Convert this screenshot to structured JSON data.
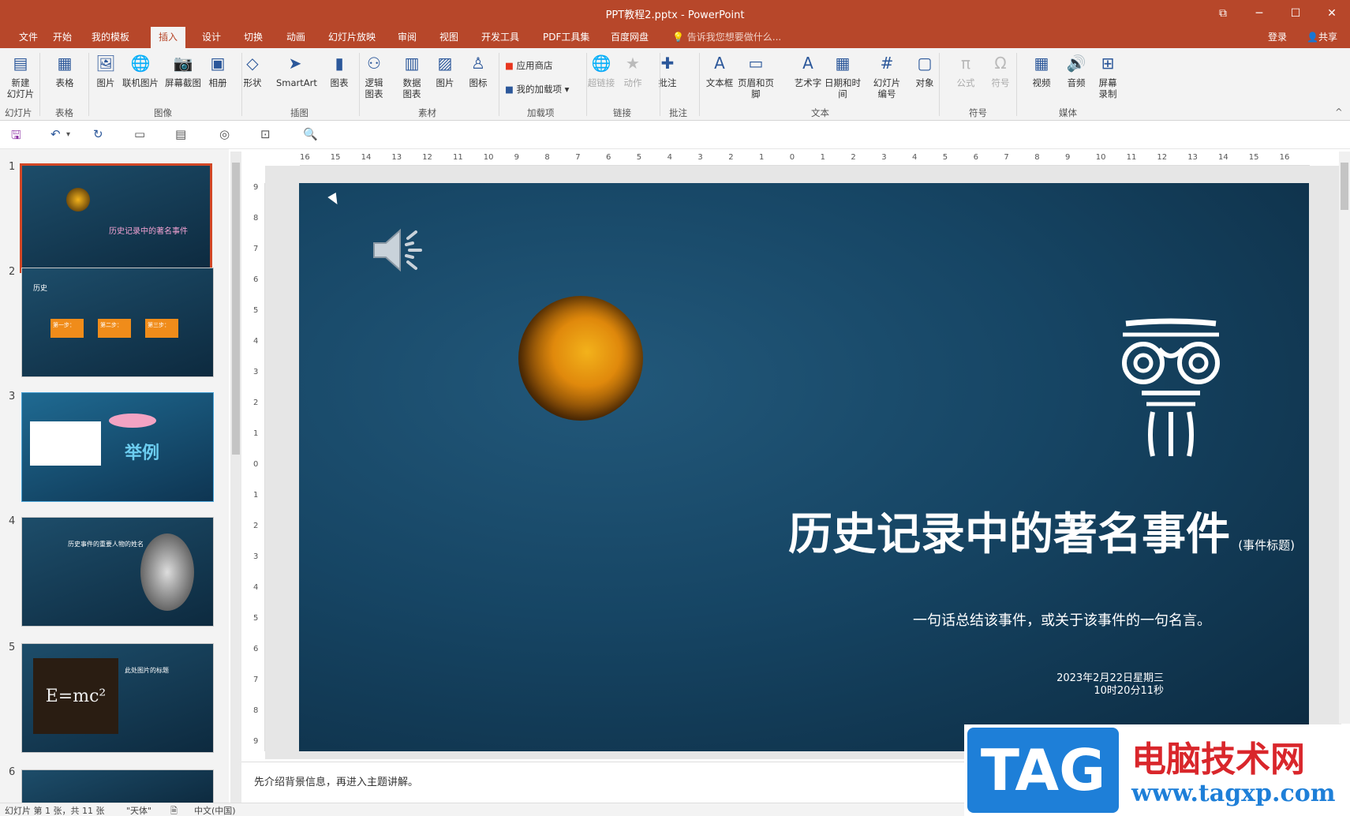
{
  "window": {
    "title": "PPT教程2.pptx - PowerPoint",
    "controls": [
      "⧉",
      "─",
      "☐",
      "✕"
    ]
  },
  "tabs": [
    {
      "label": "文件",
      "active": false
    },
    {
      "label": "开始",
      "active": false
    },
    {
      "label": "我的模板",
      "active": false
    },
    {
      "label": "插入",
      "active": true
    },
    {
      "label": "设计",
      "active": false
    },
    {
      "label": "切换",
      "active": false
    },
    {
      "label": "动画",
      "active": false
    },
    {
      "label": "幻灯片放映",
      "active": false
    },
    {
      "label": "审阅",
      "active": false
    },
    {
      "label": "视图",
      "active": false
    },
    {
      "label": "开发工具",
      "active": false
    },
    {
      "label": "PDF工具集",
      "active": false
    },
    {
      "label": "百度网盘",
      "active": false
    }
  ],
  "tellme": "告诉我您想要做什么...",
  "login": "登录",
  "share": "共享",
  "ribbon": {
    "buttons": [
      {
        "l1": "新建",
        "l2": "幻灯片",
        "icon": "new-slide-icon",
        "glyph": "▤",
        "dis": false
      },
      {
        "l1": "表格",
        "l2": "",
        "icon": "table-icon",
        "glyph": "▦",
        "dis": false
      },
      {
        "l1": "图片",
        "l2": "",
        "icon": "picture-icon",
        "glyph": "🖼",
        "dis": false
      },
      {
        "l1": "联机图片",
        "l2": "",
        "icon": "online-picture-icon",
        "glyph": "🌐",
        "dis": false
      },
      {
        "l1": "屏幕截图",
        "l2": "",
        "icon": "screenshot-icon",
        "glyph": "📷",
        "dis": false
      },
      {
        "l1": "相册",
        "l2": "",
        "icon": "album-icon",
        "glyph": "▣",
        "dis": false
      },
      {
        "l1": "形状",
        "l2": "",
        "icon": "shapes-icon",
        "glyph": "◇",
        "dis": false
      },
      {
        "l1": "SmartArt",
        "l2": "",
        "icon": "smartart-icon",
        "glyph": "➤",
        "dis": false
      },
      {
        "l1": "图表",
        "l2": "",
        "icon": "chart-icon",
        "glyph": "▮",
        "dis": false
      },
      {
        "l1": "逻辑",
        "l2": "图表",
        "icon": "logic-chart-icon",
        "glyph": "⚇",
        "dis": false
      },
      {
        "l1": "数据",
        "l2": "图表",
        "icon": "data-chart-icon",
        "glyph": "▥",
        "dis": false
      },
      {
        "l1": "图片",
        "l2": "",
        "icon": "picture2-icon",
        "glyph": "▨",
        "dis": false
      },
      {
        "l1": "图标",
        "l2": "",
        "icon": "icons-icon",
        "glyph": "♙",
        "dis": false
      },
      {
        "l1": "超链接",
        "l2": "",
        "icon": "hyperlink-icon",
        "glyph": "🌐",
        "dis": true
      },
      {
        "l1": "动作",
        "l2": "",
        "icon": "action-icon",
        "glyph": "★",
        "dis": true
      },
      {
        "l1": "批注",
        "l2": "",
        "icon": "comment-icon",
        "glyph": "✚",
        "dis": false
      },
      {
        "l1": "文本框",
        "l2": "",
        "icon": "textbox-icon",
        "glyph": "A",
        "dis": false
      },
      {
        "l1": "页眉和页脚",
        "l2": "",
        "icon": "header-footer-icon",
        "glyph": "▭",
        "dis": false
      },
      {
        "l1": "艺术字",
        "l2": "",
        "icon": "wordart-icon",
        "glyph": "A",
        "dis": false
      },
      {
        "l1": "日期和时间",
        "l2": "",
        "icon": "datetime-icon",
        "glyph": "▦",
        "dis": false
      },
      {
        "l1": "幻灯片",
        "l2": "编号",
        "icon": "slide-number-icon",
        "glyph": "#",
        "dis": false
      },
      {
        "l1": "对象",
        "l2": "",
        "icon": "object-icon",
        "glyph": "▢",
        "dis": false
      },
      {
        "l1": "公式",
        "l2": "",
        "icon": "equation-icon",
        "glyph": "π",
        "dis": true
      },
      {
        "l1": "符号",
        "l2": "",
        "icon": "symbol-icon",
        "glyph": "Ω",
        "dis": true
      },
      {
        "l1": "视频",
        "l2": "",
        "icon": "video-icon",
        "glyph": "▦",
        "dis": false
      },
      {
        "l1": "音频",
        "l2": "",
        "icon": "audio-icon",
        "glyph": "🔊",
        "dis": false
      },
      {
        "l1": "屏幕",
        "l2": "录制",
        "icon": "screen-record-icon",
        "glyph": "⊞",
        "dis": false
      }
    ],
    "small": {
      "store": "应用商店",
      "addins": "我的加载项"
    },
    "groups": [
      "幻灯片",
      "表格",
      "图像",
      "插图",
      "素材",
      "加载项",
      "链接",
      "批注",
      "文本",
      "符号",
      "媒体"
    ]
  },
  "thumbnails": {
    "numbers": [
      "1",
      "2",
      "3",
      "4",
      "5",
      "6"
    ],
    "t1": {
      "title": "历史记录中的著名事件"
    },
    "t2": {
      "title": "历史",
      "steps": [
        "第一步：",
        "第二步：",
        "第三步："
      ]
    },
    "t3": {
      "title": "举例"
    },
    "t4": {
      "title": "历史事件的重要人物的姓名"
    },
    "t5": {
      "title": "此处图片的标题",
      "formula": "E=mc²"
    }
  },
  "ruler": {
    "h": [
      "16",
      "15",
      "14",
      "13",
      "12",
      "11",
      "10",
      "9",
      "8",
      "7",
      "6",
      "5",
      "4",
      "3",
      "2",
      "1",
      "0",
      "1",
      "2",
      "3",
      "4",
      "5",
      "6",
      "7",
      "8",
      "9",
      "10",
      "11",
      "12",
      "13",
      "14",
      "15",
      "16"
    ],
    "v": [
      "9",
      "8",
      "7",
      "6",
      "5",
      "4",
      "3",
      "2",
      "1",
      "0",
      "1",
      "2",
      "3",
      "4",
      "5",
      "6",
      "7",
      "8",
      "9"
    ]
  },
  "slide": {
    "title": "历史记录中的著名事件",
    "subtitle": "(事件标题)",
    "quote": "一句话总结该事件，或关于该事件的一句名言。",
    "date": "2023年2月22日星期三",
    "time": "10时20分11秒"
  },
  "notes": "先介绍背景信息，再进入主题讲解。",
  "status": {
    "slide": "幻灯片 第 1 张，共 11 张",
    "theme": "\"天体\"",
    "lang": "中文(中国)"
  },
  "watermark": {
    "tag": "TAG",
    "cn": "电脑技术网",
    "url": "www.tagxp.com"
  },
  "colors": {
    "accent": "#b7472a",
    "slide_bg": "#164564"
  }
}
